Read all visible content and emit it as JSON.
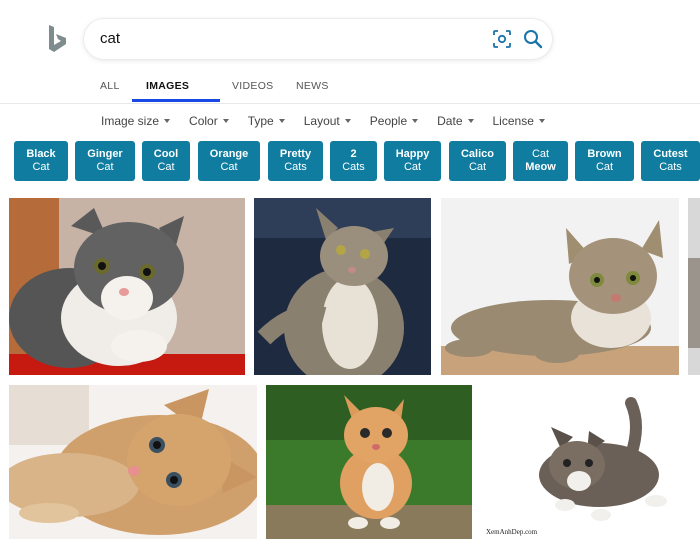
{
  "search": {
    "query": "cat"
  },
  "tabs": [
    {
      "label": "ALL",
      "active": false
    },
    {
      "label": "IMAGES",
      "active": true
    },
    {
      "label": "VIDEOS",
      "active": false
    },
    {
      "label": "NEWS",
      "active": false
    }
  ],
  "filters": [
    "Image size",
    "Color",
    "Type",
    "Layout",
    "People",
    "Date",
    "License"
  ],
  "chips": [
    {
      "line1": "Black",
      "line2": "Cat"
    },
    {
      "line1": "Ginger",
      "line2": "Cat"
    },
    {
      "line1": "Cool",
      "line2": "Cat"
    },
    {
      "line1": "Orange",
      "line2": "Cat"
    },
    {
      "line1": "Pretty",
      "line2": "Cats"
    },
    {
      "line1": "2",
      "line2": "Cats"
    },
    {
      "line1": "Happy",
      "line2": "Cat"
    },
    {
      "line1": "Calico",
      "line2": "Cat"
    },
    {
      "line1": "Cat",
      "line2": "Meow"
    },
    {
      "line1": "Brown",
      "line2": "Cat"
    },
    {
      "line1": "Cutest",
      "line2": "Cats"
    }
  ],
  "images": [
    {
      "subject": "gray and white kitten"
    },
    {
      "subject": "tabby cat sitting"
    },
    {
      "subject": "tabby kitten lying"
    },
    {
      "subject": "orange kitten lying"
    },
    {
      "subject": "ginger kitten on grass"
    },
    {
      "subject": "tabby kitten walking",
      "watermark": "XemAnhDep.com"
    }
  ],
  "colors": {
    "chip_bg": "#0f7ca0",
    "tab_underline": "#174ae4",
    "bing_logo": "#7f8c8d"
  },
  "icons": {
    "logo": "bing-logo-icon",
    "visual_search": "visual-search-icon",
    "search": "magnifier-icon",
    "caret": "caret-down-icon"
  }
}
